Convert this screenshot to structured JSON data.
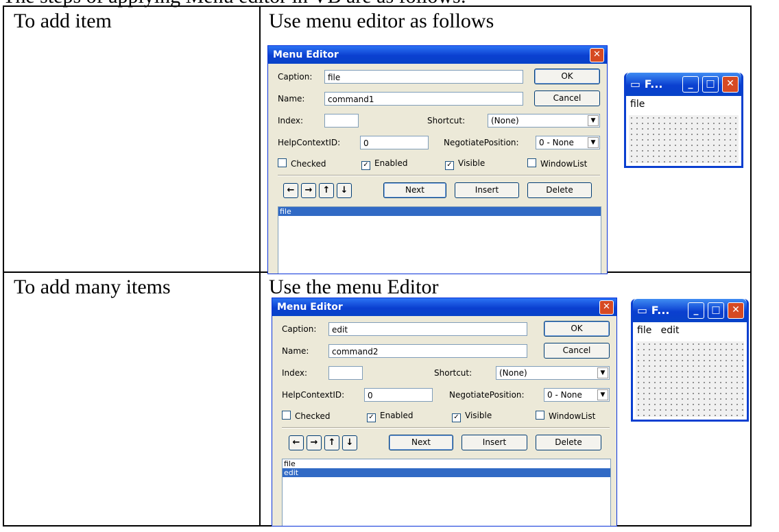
{
  "intro": "The steps of applying Menu editor in VB are as follows:",
  "rows": [
    {
      "label": "To add item",
      "heading": "Use menu editor as follows",
      "dialog": {
        "title": "Menu Editor",
        "caption_label": "Caption:",
        "caption_value": "file",
        "name_label": "Name:",
        "name_value": "command1",
        "index_label": "Index:",
        "index_value": "",
        "shortcut_label": "Shortcut:",
        "shortcut_value": "(None)",
        "helpctx_label": "HelpContextID:",
        "helpctx_value": "0",
        "negotiate_label": "NegotiatePosition:",
        "negotiate_value": "0 - None",
        "checked": "Checked",
        "enabled": "Enabled",
        "visible": "Visible",
        "windowlist": "WindowList",
        "ok": "OK",
        "cancel": "Cancel",
        "next": "Next",
        "insert": "Insert",
        "delete": "Delete",
        "items": [
          "file"
        ]
      },
      "form": {
        "title": "F...",
        "menu": "file"
      }
    },
    {
      "label": "To add many items",
      "heading": "Use the menu Editor",
      "dialog": {
        "title": "Menu Editor",
        "caption_label": "Caption:",
        "caption_value": "edit",
        "name_label": "Name:",
        "name_value": "command2",
        "index_label": "Index:",
        "index_value": "",
        "shortcut_label": "Shortcut:",
        "shortcut_value": "(None)",
        "helpctx_label": "HelpContextID:",
        "helpctx_value": "0",
        "negotiate_label": "NegotiatePosition:",
        "negotiate_value": "0 - None",
        "checked": "Checked",
        "enabled": "Enabled",
        "visible": "Visible",
        "windowlist": "WindowList",
        "ok": "OK",
        "cancel": "Cancel",
        "next": "Next",
        "insert": "Insert",
        "delete": "Delete",
        "items": [
          "file",
          "edit"
        ]
      },
      "form": {
        "title": "F...",
        "menu": "file   edit"
      }
    }
  ]
}
